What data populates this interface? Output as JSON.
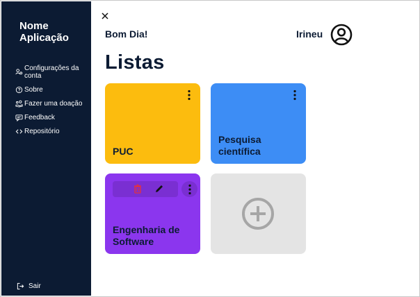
{
  "sidebar": {
    "app_name": "Nome Aplicação",
    "items": [
      {
        "label": "Configurações da conta",
        "icon": "users-settings-icon"
      },
      {
        "label": "Sobre",
        "icon": "help-circle-icon"
      },
      {
        "label": "Fazer uma doação",
        "icon": "donate-icon"
      },
      {
        "label": "Feedback",
        "icon": "feedback-icon"
      },
      {
        "label": "Repositório",
        "icon": "code-icon"
      }
    ],
    "logout_label": "Sair"
  },
  "header": {
    "greeting": "Bom Dia!",
    "user_name": "Irineu",
    "page_title": "Listas"
  },
  "lists": [
    {
      "title": "PUC",
      "color": "#fcbc0e"
    },
    {
      "title": "Pesquisa científica",
      "color": "#3d8df5"
    },
    {
      "title": "Engenharia de Software",
      "color": "#8b36ee",
      "actions": [
        "trash-icon",
        "pencil-icon"
      ]
    }
  ],
  "add_card_color": "#e4e4e4",
  "colors": {
    "sidebar_bg": "#0c1b33",
    "delete_icon": "#e8303a"
  }
}
